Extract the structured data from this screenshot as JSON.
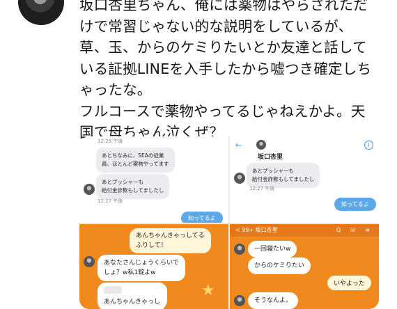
{
  "tweet": {
    "lines": [
      "坂口杏里ちゃん、俺には薬物はやらされただ",
      "けで常習じゃない的な説明をしているが、",
      "草、玉、からのケミりたいとか友達と話して",
      "いる証拠LINEを入手したから嘘つき確定しち",
      "ゃったな。",
      "フルコースで薬物やってるじゃねえかよ。天",
      "国で母ちゃん泣くぜ？"
    ]
  },
  "media": {
    "panel1": {
      "time_top": "12:26 午後",
      "msg1": [
        "あとちなみに、SEAの従業",
        "員、ほとんど薬物やってます"
      ],
      "msg2": [
        "あとブッシャーも",
        "給付金詐欺もしてましたし"
      ],
      "time_bottom": "12:27 午後",
      "reply": "知ってるよ"
    },
    "panel2": {
      "back": "←",
      "name": "坂口杏里",
      "info": "i",
      "msg": [
        "あとプッシャーも",
        "給付金詐欺もしてましたし"
      ],
      "time": "12:27 午後",
      "reply": "知ってるよ"
    },
    "panel3": {
      "msg1": [
        "あんちゃんきゃっしてる",
        "ふりして！"
      ],
      "msg2": [
        "あなたさんじょうくらいで",
        "しょ？w私1錠よw"
      ],
      "msg3": "あんちゃんきゃっし"
    },
    "panel4": {
      "header": "< 99+  坂口杏里",
      "icons": "Q ☏ ≡",
      "msg1": "一回寝たいw",
      "msg2": "からのケミりたい",
      "reply": "いやよった",
      "msg3": "そうなんよ。"
    }
  }
}
